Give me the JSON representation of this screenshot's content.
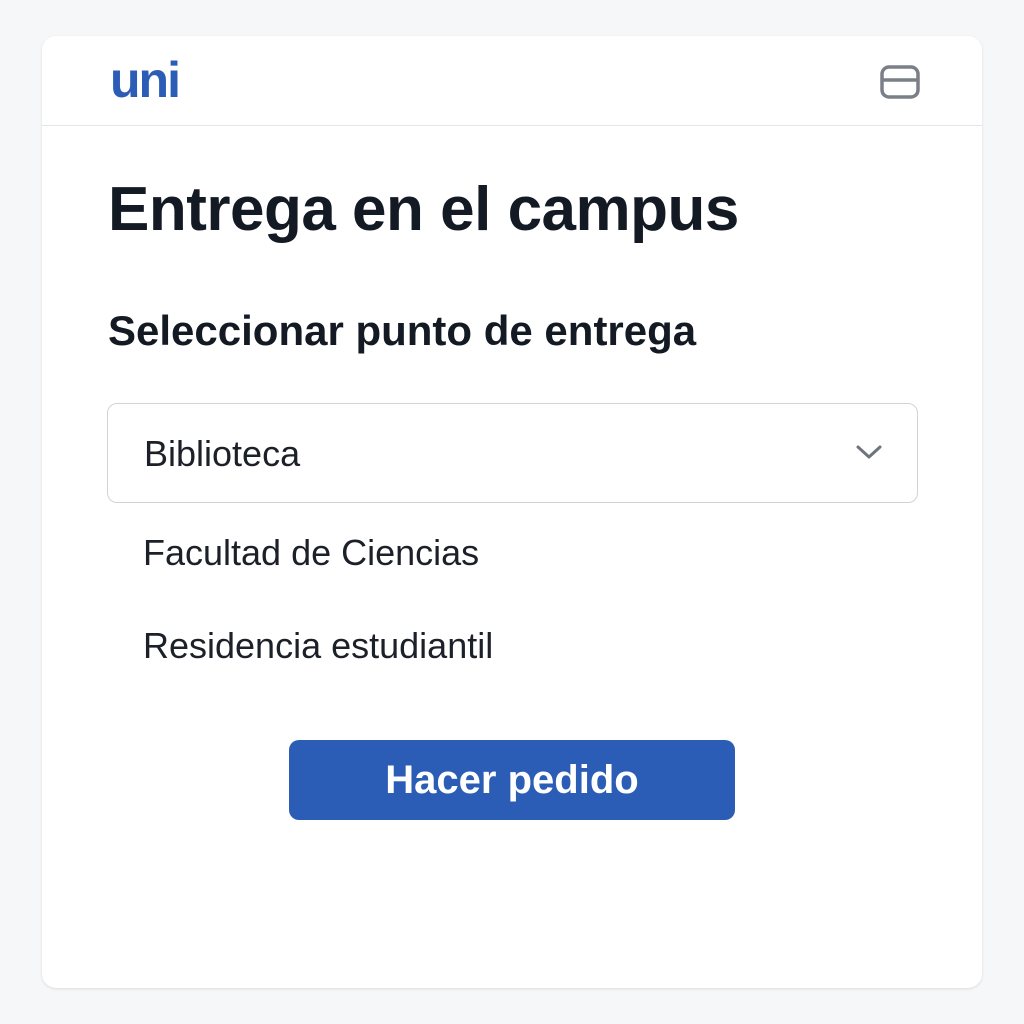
{
  "header": {
    "logo_text": "uni",
    "menu_icon": "menu-icon"
  },
  "colors": {
    "brand": "#2c5db6",
    "title_text": "#141a23",
    "icon_gray": "#7b8088",
    "border": "#cfd4da"
  },
  "main": {
    "title": "Entrega en el campus",
    "subtitle": "Seleccionar punto de entrega",
    "dropdown": {
      "selected": "Biblioteca",
      "icon": "chevron-down-icon",
      "options": [
        "Facultad de Ciencias",
        "Residencia estudiantil"
      ]
    },
    "order_button_label": "Hacer pedido"
  }
}
